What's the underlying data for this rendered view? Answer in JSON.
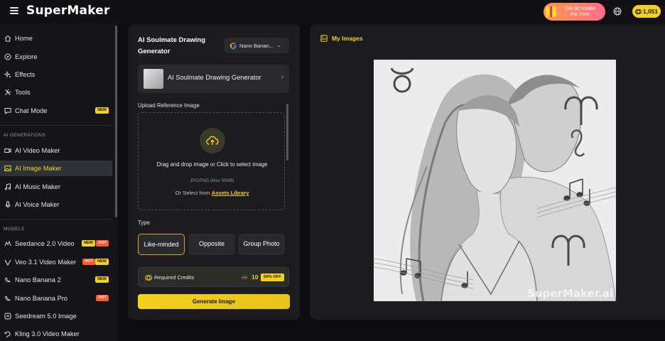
{
  "app": {
    "logo": "SuperMaker"
  },
  "topbar": {
    "promo_line1": "Get 30 credits",
    "promo_line2": "For Free",
    "credits": "1,051"
  },
  "sidebar": {
    "main": [
      {
        "label": "Home",
        "icon": "home-icon"
      },
      {
        "label": "Explore",
        "icon": "compass-icon"
      },
      {
        "label": "Effects",
        "icon": "sparkle-icon"
      },
      {
        "label": "Tools",
        "icon": "tools-icon"
      },
      {
        "label": "Chat Mode",
        "icon": "chat-icon",
        "badge": "NEW"
      }
    ],
    "gen_section": "AI GENERATIONS",
    "generations": [
      {
        "label": "AI Video Maker",
        "icon": "video-icon"
      },
      {
        "label": "AI Image Maker",
        "icon": "image-icon",
        "active": true
      },
      {
        "label": "AI Music Maker",
        "icon": "music-icon"
      },
      {
        "label": "AI Voice Maker",
        "icon": "mic-icon"
      }
    ],
    "models_section": "MODELS",
    "models": [
      {
        "label": "Seedance 2.0 Video",
        "badges": [
          "NEW",
          "HOT"
        ]
      },
      {
        "label": "Veo 3.1 Video Maker",
        "badges": [
          "HOT",
          "NEW"
        ]
      },
      {
        "label": "Nano Banana 2",
        "badges": [
          "NEW"
        ]
      },
      {
        "label": "Nano Banana Pro",
        "badges": [
          "HOT"
        ]
      },
      {
        "label": "Seedream 5.0 Image",
        "badges": []
      },
      {
        "label": "Kling 3.0 Video Maker",
        "badges": []
      }
    ]
  },
  "panel": {
    "title": "AI Soulmate Drawing Generator",
    "model": "Nano Banan...",
    "template_name": "AI Soulmate Drawing Generator",
    "upload_label": "Upload Reference Image",
    "upload_main": "Drag and drop image or Click to select image",
    "upload_sub": "JPG/PNG (Max 30MB)",
    "upload_or": "Or Select from",
    "upload_link": "Assets Library",
    "type_label": "Type",
    "types": [
      "Like-minded",
      "Opposite",
      "Group Photo"
    ],
    "credits_label": "Required Credits",
    "credits_old": "20",
    "credits_new": "10",
    "credits_off": "50% OFF",
    "generate": "Generate Image"
  },
  "images": {
    "title": "My Images",
    "watermark": "SuperMaker.ai"
  },
  "colors": {
    "accent": "#f3d11c",
    "hot": "#ff5a2a",
    "bg": "#0d0d0f",
    "panel": "#1c1c1f"
  }
}
